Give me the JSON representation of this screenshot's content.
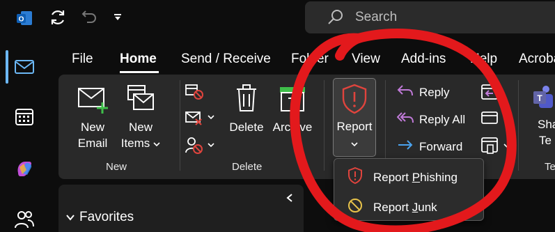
{
  "search": {
    "placeholder": "Search"
  },
  "menu": {
    "tabs": [
      "File",
      "Home",
      "Send / Receive",
      "Folder",
      "View",
      "Add-ins",
      "Help",
      "Acrobat"
    ],
    "active": "Home"
  },
  "ribbon": {
    "new_group": {
      "label": "New",
      "new_email": [
        "New",
        "Email"
      ],
      "new_items": [
        "New",
        "Items"
      ]
    },
    "delete_group": {
      "label": "Delete",
      "delete": "Delete",
      "archive": "Archive"
    },
    "report": {
      "label": "Report"
    },
    "respond": {
      "reply": "Reply",
      "reply_all": "Reply All",
      "forward": "Forward"
    },
    "teams": {
      "label_line1": "Sha",
      "label_line2": "Te",
      "group_fragment": "Te"
    }
  },
  "dropdown": {
    "report_phishing": {
      "before": "Report ",
      "underline": "P",
      "after": "hishing"
    },
    "report_junk": {
      "before": "Report ",
      "underline": "J",
      "after": "unk"
    }
  },
  "folder_pane": {
    "favorites": "Favorites"
  },
  "colors": {
    "background": "#0d0d0d",
    "ribbon": "#292929",
    "accent_blue": "#6cb8f6",
    "report_red": "#e0443d",
    "annotation": "#e3191c"
  }
}
